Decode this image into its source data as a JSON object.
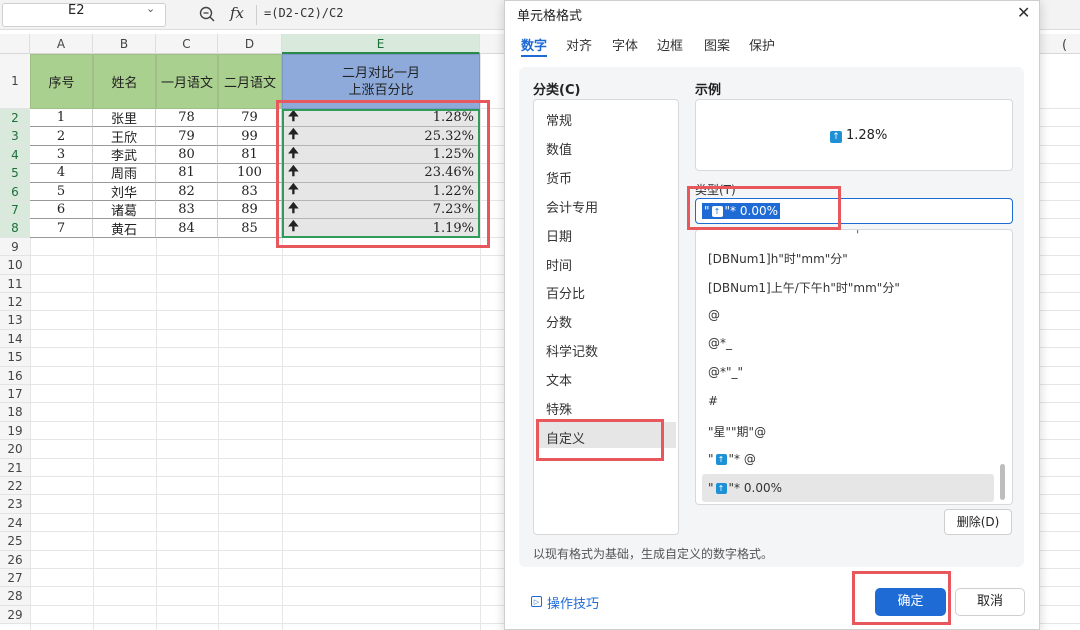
{
  "formula_bar": {
    "name_box": "E2",
    "name_box_arrow": "⌄",
    "fx": "fx",
    "formula": "=(D2-C2)/C2"
  },
  "columns": [
    "A",
    "B",
    "C",
    "D",
    "E"
  ],
  "right_edge_col_fragment": "(",
  "rows": [
    "1",
    "2",
    "3",
    "4",
    "5",
    "6",
    "7",
    "8",
    "9",
    "10",
    "11",
    "12",
    "13",
    "14",
    "15",
    "16",
    "17",
    "18",
    "19",
    "20",
    "21",
    "22",
    "23",
    "24",
    "25",
    "26",
    "27",
    "28",
    "29"
  ],
  "table": {
    "headers": [
      "序号",
      "姓名",
      "一月语文",
      "二月语文"
    ],
    "header_e_line1": "二月对比一月",
    "header_e_line2": "上涨百分比",
    "arrow": "🠉",
    "data": [
      [
        "1",
        "张里",
        "78",
        "79",
        "1.28%"
      ],
      [
        "2",
        "王欣",
        "79",
        "99",
        "25.32%"
      ],
      [
        "3",
        "李武",
        "80",
        "81",
        "1.25%"
      ],
      [
        "4",
        "周雨",
        "81",
        "100",
        "23.46%"
      ],
      [
        "5",
        "刘华",
        "82",
        "83",
        "1.22%"
      ],
      [
        "6",
        "诸葛",
        "83",
        "89",
        "7.23%"
      ],
      [
        "7",
        "黄石",
        "84",
        "85",
        "1.19%"
      ]
    ]
  },
  "dialog": {
    "title": "单元格格式",
    "close": "✕",
    "tabs": [
      "数字",
      "对齐",
      "字体",
      "边框",
      "图案",
      "保护"
    ],
    "category_label": "分类(C)",
    "categories": [
      "常规",
      "数值",
      "货币",
      "会计专用",
      "日期",
      "时间",
      "百分比",
      "分数",
      "科学记数",
      "文本",
      "特殊",
      "自定义"
    ],
    "selected_category": "自定义",
    "sample_label": "示例",
    "sample_icon": "↑",
    "sample_value": "1.28%",
    "type_label": "类型(T)",
    "type_value_prefix": "\"",
    "type_value_icon": "↑",
    "type_value_suffix": "\"* 0.00%",
    "format_list_top_fragment": "'",
    "formats": [
      "[DBNum1]h\"时\"mm\"分\"",
      "[DBNum1]上午/下午h\"时\"mm\"分\"",
      "@",
      "@*_",
      "@*\"_\"",
      "#",
      "\"星\"\"期\"@"
    ],
    "format_icon_item": {
      "prefix": "\"",
      "icon": "↑",
      "suffix": "\"* @"
    },
    "format_selected_item": {
      "prefix": "\"",
      "icon": "↑",
      "suffix": "\"* 0.00%"
    },
    "delete_button": "删除(D)",
    "hint": "以现有格式为基础，生成自定义的数字格式。",
    "tips_icon": "▷",
    "tips_link": "操作技巧",
    "ok_button": "确定",
    "cancel_button": "取消"
  },
  "colors": {
    "header_green": "#a9d08e",
    "header_blue": "#8eaadb",
    "accent_blue": "#1e6bd6",
    "highlight_red": "#e8575b",
    "selection_green": "#2f9c5a"
  }
}
